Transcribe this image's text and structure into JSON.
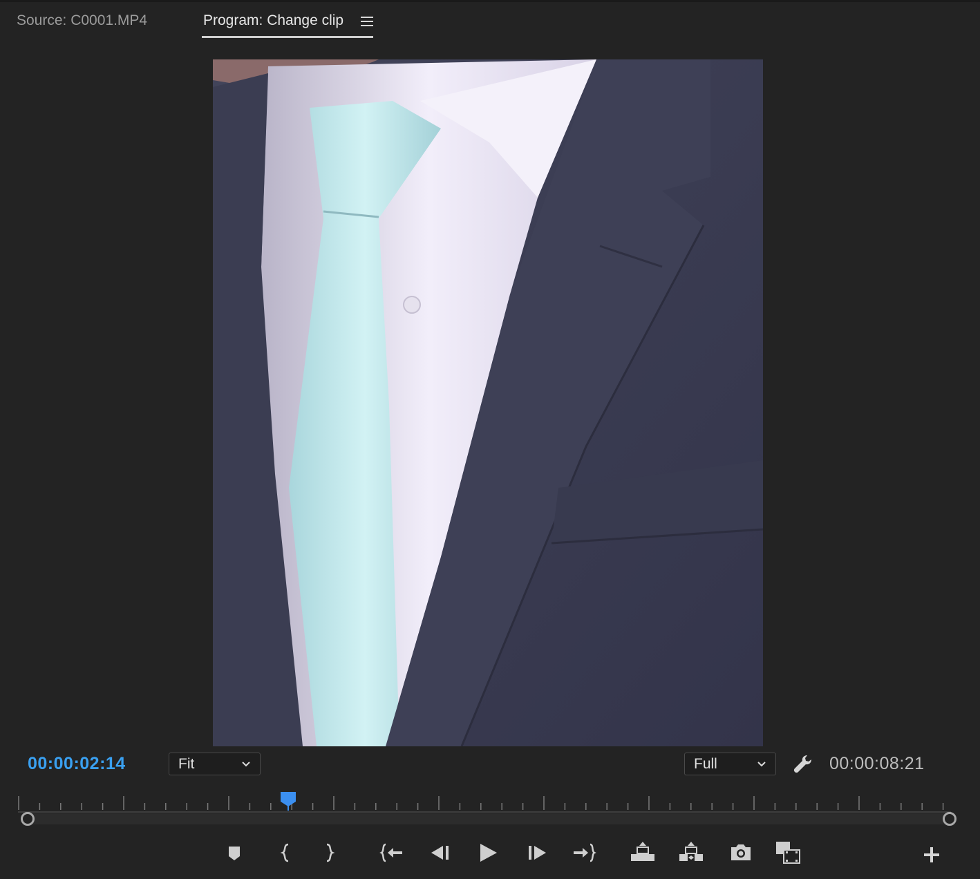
{
  "tabs": {
    "source_label": "Source: C0001.MP4",
    "program_label": "Program: Change clip"
  },
  "monitor": {
    "current_timecode": "00:00:02:14",
    "duration_timecode": "00:00:08:21",
    "zoom_level": "Fit",
    "playback_resolution": "Full",
    "playhead_position_fraction": 0.285
  },
  "icons": {
    "panel_menu": "hamburger-icon",
    "settings": "wrench-icon",
    "transport": [
      "add-marker-icon",
      "mark-in-icon",
      "mark-out-icon",
      "go-to-in-icon",
      "step-back-icon",
      "play-icon",
      "step-forward-icon",
      "go-to-out-icon",
      "lift-icon",
      "extract-icon",
      "export-frame-icon",
      "comparison-view-icon",
      "button-editor-plus-icon"
    ]
  },
  "colors": {
    "accent": "#3aa0f0",
    "panel_bg": "#232323",
    "text_primary": "#e6e6e6",
    "text_secondary": "#9b9b9b"
  }
}
